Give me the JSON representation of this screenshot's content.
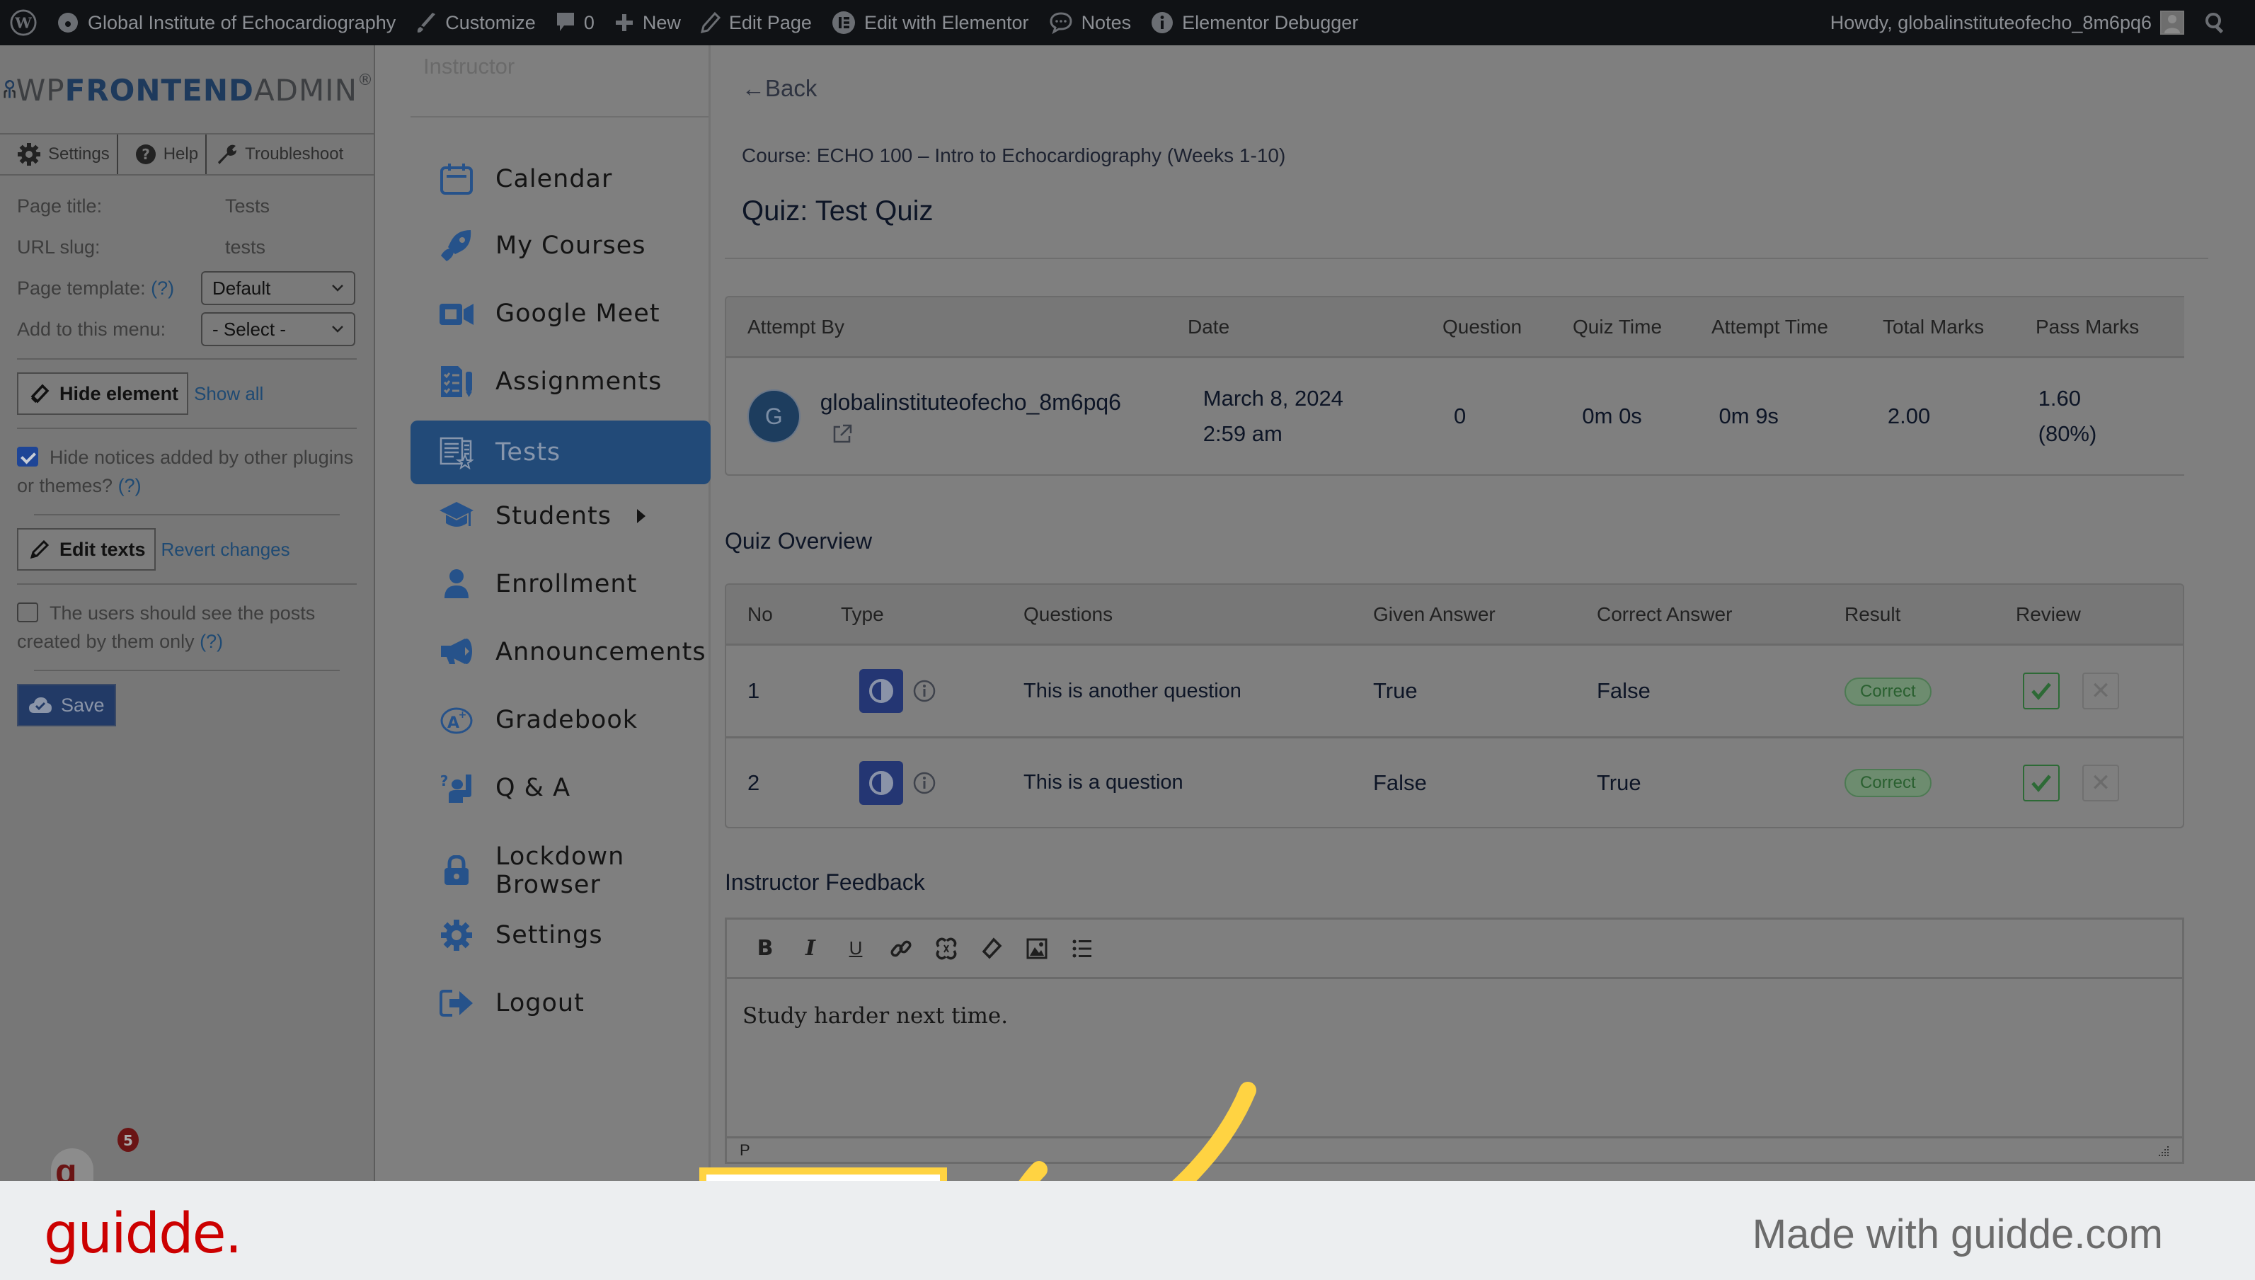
{
  "adminbar": {
    "site_name": "Global Institute of Echocardiography",
    "customize": "Customize",
    "comments_count": "0",
    "new": "New",
    "edit_page": "Edit Page",
    "edit_with_elementor": "Edit with Elementor",
    "notes": "Notes",
    "elementor_debugger": "Elementor Debugger",
    "howdy": "Howdy, globalinstituteofecho_8m6pq6"
  },
  "wpfa": {
    "logo": {
      "pre": "WP",
      "bold": "FRONTEND",
      "post": "ADMIN",
      "reg": "®"
    },
    "tabs": [
      "Settings",
      "Help",
      "Troubleshoot"
    ],
    "page_title_label": "Page title:",
    "page_title_value": "Tests",
    "url_slug_label": "URL slug:",
    "url_slug_value": "tests",
    "page_template_label": "Page template:",
    "help_link": "(?)",
    "page_template_value": "Default",
    "menu_label": "Add to this menu:",
    "menu_value": "- Select -",
    "hide_element": "Hide element",
    "show_all": "Show all",
    "hide_notices": "Hide notices added by other plugins or themes?",
    "hide_notices_checked": true,
    "edit_texts": "Edit texts",
    "revert_changes": "Revert changes",
    "own_posts": "The users should see the posts created by them only",
    "own_posts_checked": false,
    "save": "Save",
    "notification_count": "5"
  },
  "nav": {
    "role": "Instructor",
    "items": [
      {
        "label": "Calendar",
        "icon": "calendar-icon"
      },
      {
        "label": "My Courses",
        "icon": "rocket-icon"
      },
      {
        "label": "Google Meet",
        "icon": "video-camera-icon"
      },
      {
        "label": "Assignments",
        "icon": "assignments-icon"
      },
      {
        "label": "Tests",
        "icon": "tests-icon",
        "active": true
      },
      {
        "label": "Students",
        "icon": "graduation-cap-icon",
        "has_submenu": true
      },
      {
        "label": "Enrollment",
        "icon": "user-icon"
      },
      {
        "label": "Announcements",
        "icon": "megaphone-icon"
      },
      {
        "label": "Gradebook",
        "icon": "grade-icon"
      },
      {
        "label": "Q & A",
        "icon": "question-hand-icon"
      },
      {
        "label": "Lockdown Browser",
        "icon": "lock-icon"
      },
      {
        "label": "Settings",
        "icon": "gear-icon"
      },
      {
        "label": "Logout",
        "icon": "logout-icon"
      }
    ]
  },
  "main": {
    "back": "←Back",
    "course": "Course: ECHO 100 – Intro to Echocardiography (Weeks 1-10)",
    "quiz_title": "Quiz: Test Quiz",
    "attempt_table": {
      "headers": [
        "Attempt By",
        "Date",
        "Question",
        "Quiz Time",
        "Attempt Time",
        "Total Marks",
        "Pass Marks"
      ],
      "row": {
        "avatar_initial": "G",
        "user": "globalinstituteofecho_8m6pq6",
        "date": "March 8, 2024",
        "time": "2:59 am",
        "question": "0",
        "quiz_time": "0m 0s",
        "attempt_time": "0m 9s",
        "total_marks": "2.00",
        "pass_marks": "1.60",
        "pass_percent": "(80%)"
      }
    },
    "overview_title": "Quiz Overview",
    "overview_table": {
      "headers": [
        "No",
        "Type",
        "Questions",
        "Given Answer",
        "Correct Answer",
        "Result",
        "Review"
      ],
      "rows": [
        {
          "no": "1",
          "question": "This is another question",
          "given": "True",
          "correct": "False",
          "result": "Correct"
        },
        {
          "no": "2",
          "question": "This is a question",
          "given": "False",
          "correct": "True",
          "result": "Correct"
        }
      ]
    },
    "feedback_title": "Instructor Feedback",
    "feedback_toolbar": [
      "bold",
      "italic",
      "underline",
      "link",
      "unlink",
      "eraser",
      "image",
      "list"
    ],
    "feedback_text": "Study harder next time.",
    "feedback_path": "P"
  },
  "footer": {
    "brand": "guidde.",
    "made_with": "Made with guidde.com"
  },
  "colors": {
    "accent": "#224a78",
    "highlight": "#ffd342",
    "brand_red": "#cc0000",
    "correct_green": "#2a6030"
  }
}
